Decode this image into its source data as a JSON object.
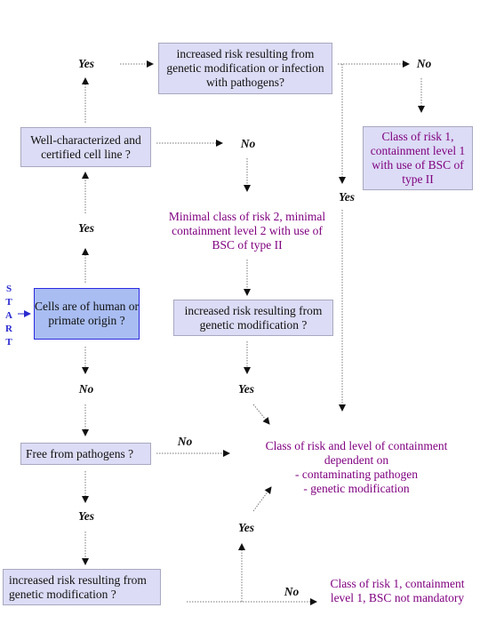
{
  "start_label": "START",
  "boxes": {
    "origin": "Cells are of human or primate origin ?",
    "well_characterized": "Well-characterized and certified cell line ?",
    "risk_gm_infection": "increased risk resulting from genetic modification or infection with pathogens?",
    "risk_gm_middle": "increased risk resulting from genetic modification ?",
    "free_pathogens": "Free from pathogens ?",
    "risk_gm_bottom": "increased risk resulting from genetic modification ?"
  },
  "outcomes": {
    "class1_bsc": "Class of risk 1, containment level 1 with  use of BSC of type II",
    "minimal_class2": "Minimal class of risk 2, minimal containment level 2 with use of BSC of type II",
    "dependent": [
      "Class of risk and level of containment",
      "dependent on",
      "- contaminating pathogen",
      "- genetic modification"
    ],
    "class1_no_bsc": "Class of risk 1, containment level 1, BSC not mandatory"
  },
  "labels": {
    "yes": "Yes",
    "no": "No"
  },
  "colors": {
    "box": "#dcdcf6",
    "start_box": "#a9bdf2",
    "outcome_text": "#800080",
    "start_text": "#2a2ad0"
  }
}
